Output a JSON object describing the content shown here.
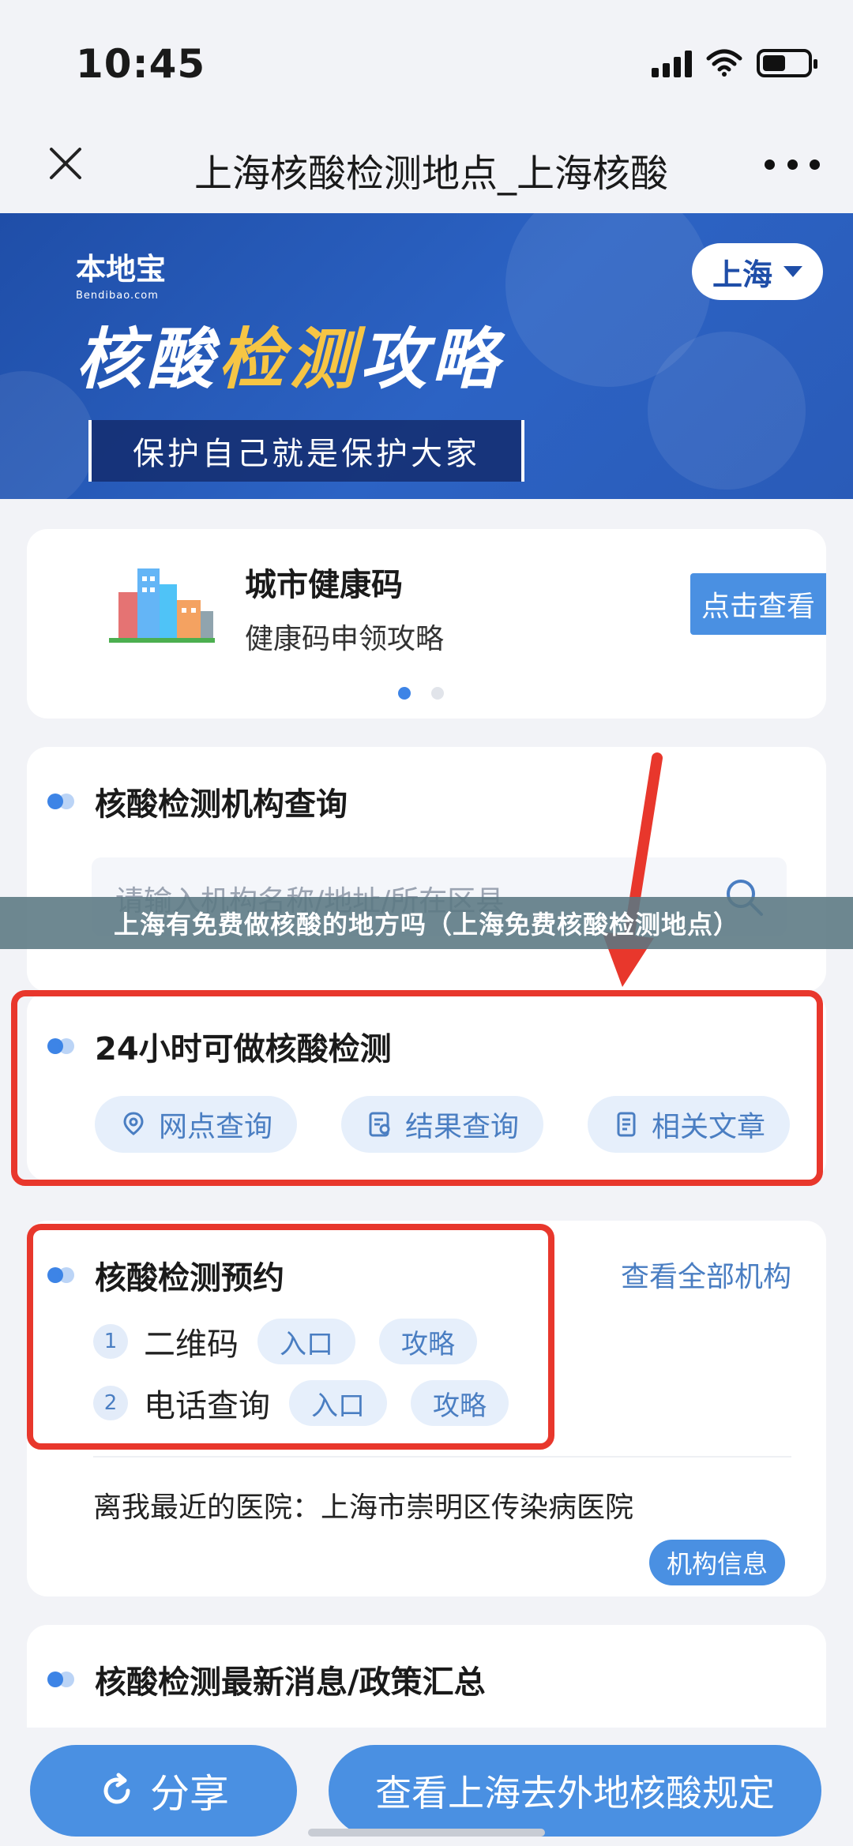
{
  "status_bar": {
    "time": "10:45"
  },
  "nav": {
    "title": "上海核酸检测地点_上海核酸"
  },
  "banner": {
    "brand_name": "本地宝",
    "brand_sub": "Bendibao.com",
    "city": "上海",
    "title_part1": "核酸",
    "title_part2": "检测",
    "title_part3": "攻略",
    "slogan": "保护自己就是保护大家"
  },
  "health_card": {
    "title": "城市健康码",
    "subtitle": "健康码申领攻略",
    "button": "点击查看"
  },
  "query_card": {
    "title": "核酸检测机构查询",
    "search_placeholder": "请输入机构名称/地址/所在区县"
  },
  "caption": "上海有免费做核酸的地方吗（上海免费核酸检测地点）",
  "card_24h": {
    "title": "24小时可做核酸检测",
    "buttons": [
      "网点查询",
      "结果查询",
      "相关文章"
    ]
  },
  "booking_card": {
    "title": "核酸检测预约",
    "view_all": "查看全部机构",
    "rows": [
      {
        "num": "1",
        "label": "二维码",
        "entry": "入口",
        "guide": "攻略"
      },
      {
        "num": "2",
        "label": "电话查询",
        "entry": "入口",
        "guide": "攻略"
      }
    ],
    "hospital_text": "离我最近的医院：上海市崇明区传染病医院",
    "inst_button": "机构信息"
  },
  "news_card": {
    "title": "核酸检测最新消息/政策汇总"
  },
  "bottom": {
    "share": "分享",
    "rules": "查看上海去外地核酸规定"
  },
  "colors": {
    "accent": "#4a90e2",
    "banner": "#2c63c4",
    "highlight": "#f6c544",
    "annotation": "#e8372c"
  }
}
